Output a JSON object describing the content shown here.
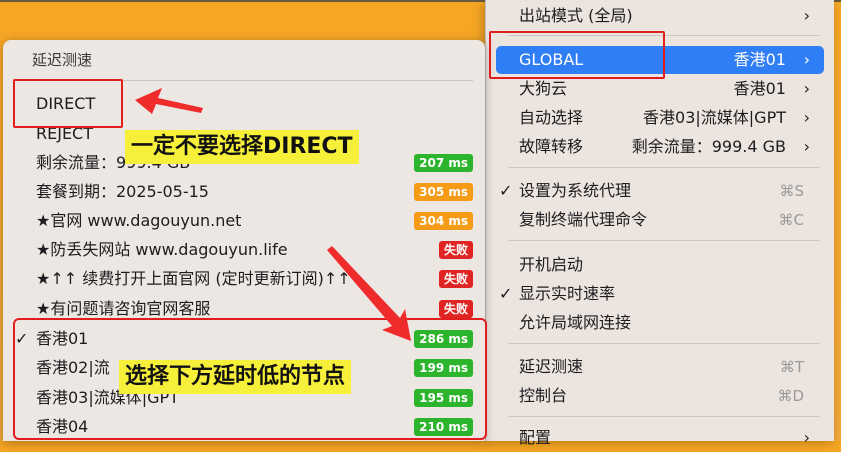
{
  "main_menu": {
    "items": [
      {
        "label": "出站模式 (全局)",
        "value": "",
        "chevron": "›",
        "check": ""
      },
      {
        "label": "GLOBAL",
        "value": "香港01",
        "chevron": "›",
        "check": ""
      },
      {
        "label": "大狗云",
        "value": "香港01",
        "chevron": "›",
        "check": ""
      },
      {
        "label": "自动选择",
        "value": "香港03|流媒体|GPT",
        "chevron": "›",
        "check": ""
      },
      {
        "label": "故障转移",
        "value": "剩余流量：999.4 GB",
        "chevron": "›",
        "check": ""
      },
      {
        "label": "设置为系统代理",
        "shortcut": "⌘S",
        "check": "✓"
      },
      {
        "label": "复制终端代理命令",
        "shortcut": "⌘C",
        "check": ""
      },
      {
        "label": "开机启动",
        "check": ""
      },
      {
        "label": "显示实时速率",
        "check": "✓"
      },
      {
        "label": "允许局域网连接",
        "check": ""
      },
      {
        "label": "延迟测速",
        "shortcut": "⌘T",
        "check": ""
      },
      {
        "label": "控制台",
        "shortcut": "⌘D",
        "check": ""
      },
      {
        "label": "配置",
        "chevron": "›",
        "check": ""
      }
    ]
  },
  "sub_menu": {
    "title": "延迟测速",
    "items": [
      {
        "label": "DIRECT",
        "latency": "",
        "check": ""
      },
      {
        "label": "REJECT",
        "latency": "",
        "check": ""
      },
      {
        "label": "剩余流量：999.4 GB",
        "latency": "207 ms",
        "check": ""
      },
      {
        "label": "套餐到期：2025-05-15",
        "latency": "305 ms",
        "check": ""
      },
      {
        "label": "★官网 www.dagouyun.net",
        "latency": "304 ms",
        "check": ""
      },
      {
        "label": "★防丢失网站 www.dagouyun.life",
        "latency": "失败",
        "check": ""
      },
      {
        "label": "★↑↑ 续费打开上面官网 (定时更新订阅)↑↑",
        "latency": "失败",
        "check": ""
      },
      {
        "label": "★有问题请咨询官网客服",
        "latency": "失败",
        "check": ""
      },
      {
        "label": "香港01",
        "latency": "286 ms",
        "check": "✓"
      },
      {
        "label": "香港02|流",
        "latency": "199 ms",
        "check": ""
      },
      {
        "label": "香港03|流媒体|GPT",
        "latency": "195 ms",
        "check": ""
      },
      {
        "label": "香港04",
        "latency": "210 ms",
        "check": ""
      }
    ]
  },
  "annotations": {
    "direct_note": "一定不要选择DIRECT",
    "node_note": "选择下方延时低的节点"
  },
  "colors": {
    "badge_green": "#2cb52c",
    "badge_orange": "#f59b16",
    "badge_red": "#e02323",
    "highlight_blue": "#2f7ef5",
    "annotation_red": "#e11d1d",
    "note_yellow": "#f7f03a"
  }
}
